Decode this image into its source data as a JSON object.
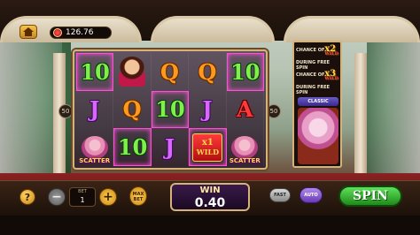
{
  "balance": {
    "value": "126.76"
  },
  "reels": [
    [
      "10",
      "lady",
      "Q",
      "Q",
      "10"
    ],
    [
      "J",
      "Q",
      "10",
      "J",
      "A"
    ],
    [
      "ganesha-scatter",
      "10",
      "J",
      "wild",
      "ganesha-scatter"
    ]
  ],
  "symbols": {
    "scatter_label": "SCATTER",
    "wild_mult": "x1",
    "wild_label": "WILD"
  },
  "lines": {
    "left": "50",
    "right": "50"
  },
  "side_panel": {
    "row1_label": "CHANCE OF",
    "row1_mult": "x2",
    "row1_sub": "WILD",
    "row2_label": "DURING FREE SPIN",
    "row3_label": "CHANCE OF",
    "row3_mult": "x3",
    "row3_sub": "WILD",
    "row4_label": "DURING FREE SPIN",
    "classic": "CLASSIC"
  },
  "controls": {
    "help": "?",
    "minus": "−",
    "plus": "+",
    "bet_label": "BET",
    "bet_value": "1",
    "maxbet_line1": "MAX",
    "maxbet_line2": "BET",
    "win_label": "WIN",
    "win_value": "0.40",
    "fast": "FAST",
    "auto": "AUTO",
    "spin": "SPIN"
  },
  "colors": {
    "spin": "#2fa82a",
    "win_frame": "#d4b27a",
    "highlight": "#ff4fd8"
  }
}
